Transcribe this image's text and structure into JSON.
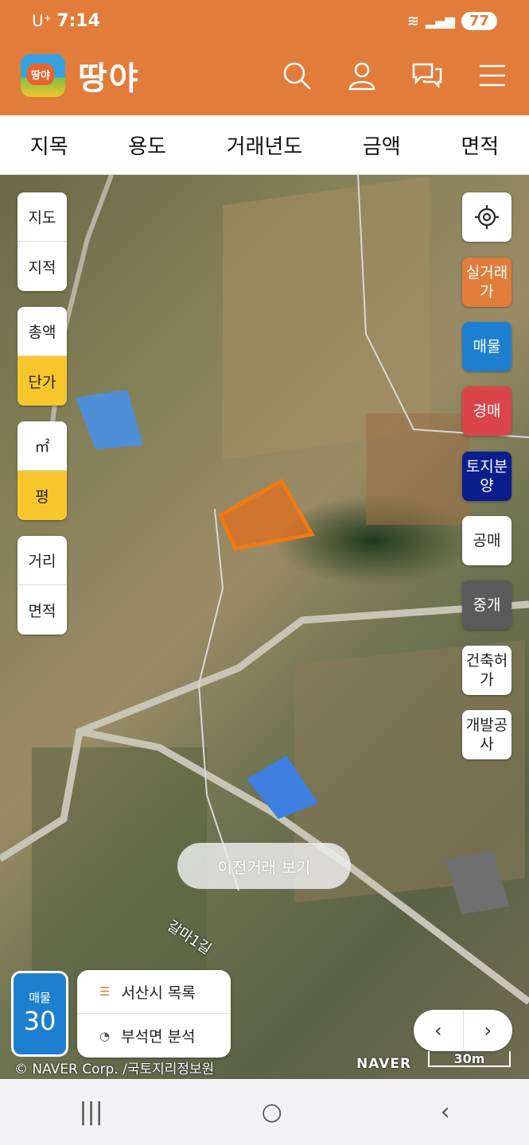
{
  "status": {
    "carrier": "U⁺",
    "time": "7:14",
    "battery": "77"
  },
  "app": {
    "name": "땅야",
    "logo_text": "땅야"
  },
  "header_icons": [
    "search-icon",
    "user-icon",
    "chat-icon",
    "menu-icon"
  ],
  "filters": [
    "지목",
    "용도",
    "거래년도",
    "금액",
    "면적"
  ],
  "left_controls": {
    "group1": [
      "지도",
      "지적"
    ],
    "group2": [
      "총액",
      "단가"
    ],
    "group3": [
      "㎡",
      "평"
    ],
    "group4": [
      "거리",
      "면적"
    ]
  },
  "right_buttons": {
    "locate": "locate-icon",
    "real_trade": "실거래가",
    "listing": "매물",
    "auction": "경매",
    "land_sale": "토지분양",
    "public_auction": "공매",
    "brokerage": "중개",
    "building_permit": "건축허가",
    "development": "개발공사"
  },
  "map": {
    "road_label": "갈마1길",
    "prev_deals_button": "이전거래 보기",
    "listing_badge": {
      "label": "매물",
      "count": "30"
    },
    "menu": {
      "list_label": "서산시 목록",
      "analysis_label": "부석면 분석"
    },
    "pager": {
      "prev": "‹",
      "next": "›"
    },
    "copyright": "© NAVER Corp. /국토지리정보원",
    "naver": "NAVER",
    "scale": "30m"
  },
  "navbar": {
    "recent": "|||",
    "home": "○",
    "back": "‹"
  },
  "colors": {
    "brand": "#E27C3A",
    "active": "#F8C72E",
    "listing": "#1E7FD0"
  }
}
